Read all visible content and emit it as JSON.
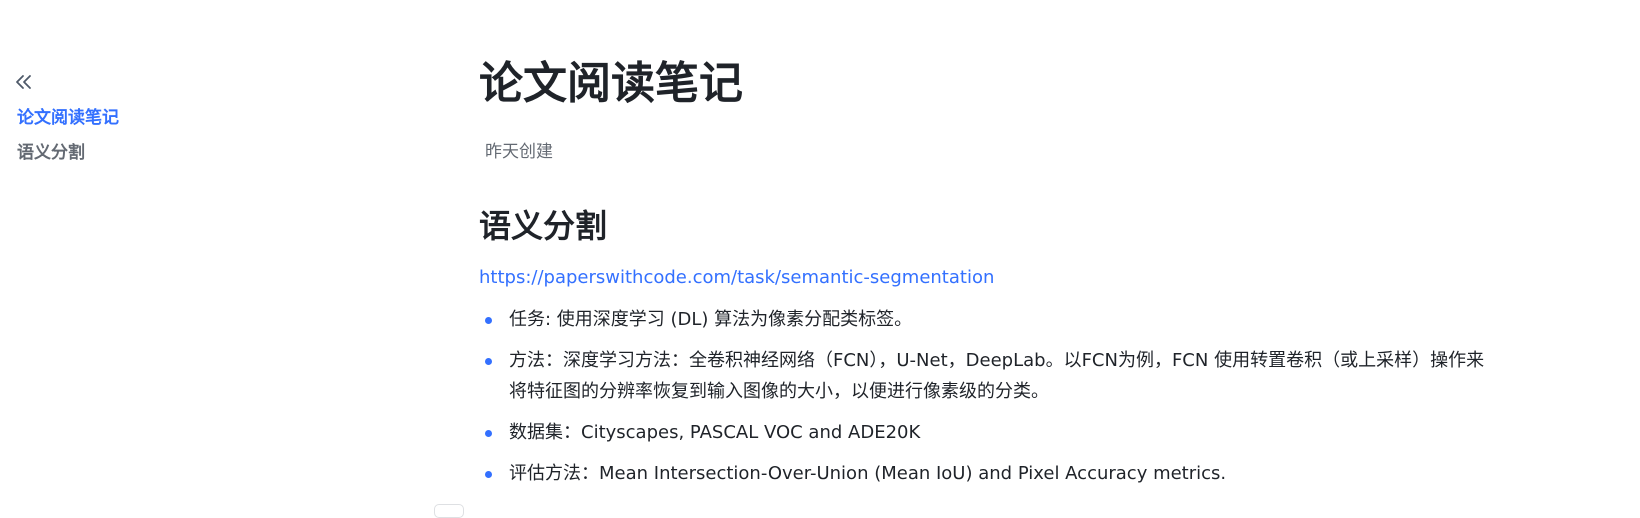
{
  "sidebar": {
    "collapse_icon": "double-chevron-left-icon",
    "toc": [
      {
        "label": "论文阅读笔记",
        "active": true
      },
      {
        "label": "语义分割",
        "active": false
      }
    ]
  },
  "document": {
    "title": "论文阅读笔记",
    "meta": "昨天创建",
    "heading": "语义分割",
    "link": "https://paperswithcode.com/task/semantic-segmentation",
    "bullets": [
      "任务: 使用深度学习 (DL) 算法为像素分配类标签。",
      "方法：深度学习方法：全卷积神经网络（FCN），U-Net，DeepLab。以FCN为例，FCN 使用转置卷积（或上采样）操作来将特征图的分辨率恢复到输入图像的大小，以便进行像素级的分类。",
      "数据集：Cityscapes, PASCAL VOC and ADE20K",
      "评估方法：Mean Intersection-Over-Union (Mean IoU) and Pixel Accuracy metrics."
    ]
  },
  "colors": {
    "accent": "#3370ff",
    "text": "#1f2329",
    "muted": "#646a73"
  }
}
